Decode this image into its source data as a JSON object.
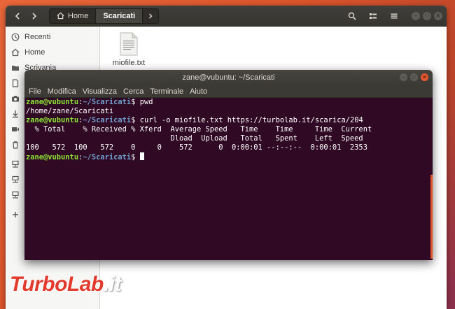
{
  "nautilus": {
    "path": {
      "home": "Home",
      "current": "Scaricati"
    },
    "sidebar": {
      "items": [
        {
          "label": "Recenti",
          "icon": "clock-icon"
        },
        {
          "label": "Home",
          "icon": "home-icon"
        },
        {
          "label": "Scrivania",
          "icon": "folder-icon"
        },
        {
          "label": "",
          "icon": "document-icon"
        },
        {
          "label": "",
          "icon": "camera-icon"
        },
        {
          "label": "",
          "icon": "download-icon"
        },
        {
          "label": "",
          "icon": "video-icon"
        },
        {
          "label": "",
          "icon": "trash-icon"
        },
        {
          "label": "",
          "icon": "network-icon"
        },
        {
          "label": "",
          "icon": "network-icon"
        },
        {
          "label": "",
          "icon": "network-icon"
        },
        {
          "label": "",
          "icon": "plus-icon"
        }
      ]
    },
    "files": [
      {
        "name": "miofile.txt",
        "icon": "text-file-icon"
      }
    ]
  },
  "terminal": {
    "title": "zane@vubuntu: ~/Scaricati",
    "menu": [
      "File",
      "Modifica",
      "Visualizza",
      "Cerca",
      "Terminale",
      "Aiuto"
    ],
    "user": "zane@vubuntu",
    "cwd": "~/Scaricati",
    "prompt_suffix": "$ ",
    "lines": [
      {
        "type": "prompt",
        "cmd": "pwd"
      },
      {
        "type": "output",
        "text": "/home/zane/Scaricati"
      },
      {
        "type": "prompt",
        "cmd": "curl -o miofile.txt https://turbolab.it/scarica/204"
      },
      {
        "type": "output",
        "text": "  % Total    % Received % Xferd  Average Speed   Time    Time     Time  Current"
      },
      {
        "type": "output",
        "text": "                                 Dload  Upload   Total   Spent    Left  Speed"
      },
      {
        "type": "output",
        "text": "100   572  100   572    0     0    572      0  0:00:01 --:--:--  0:00:01  2353"
      },
      {
        "type": "prompt",
        "cmd": ""
      }
    ]
  },
  "watermark": {
    "part1": "TurboLab",
    "part2": ".it"
  },
  "colors": {
    "terminal_bg": "#300a24",
    "prompt_user": "#8ae234",
    "prompt_path": "#729fcf",
    "accent": "#e4572e"
  }
}
